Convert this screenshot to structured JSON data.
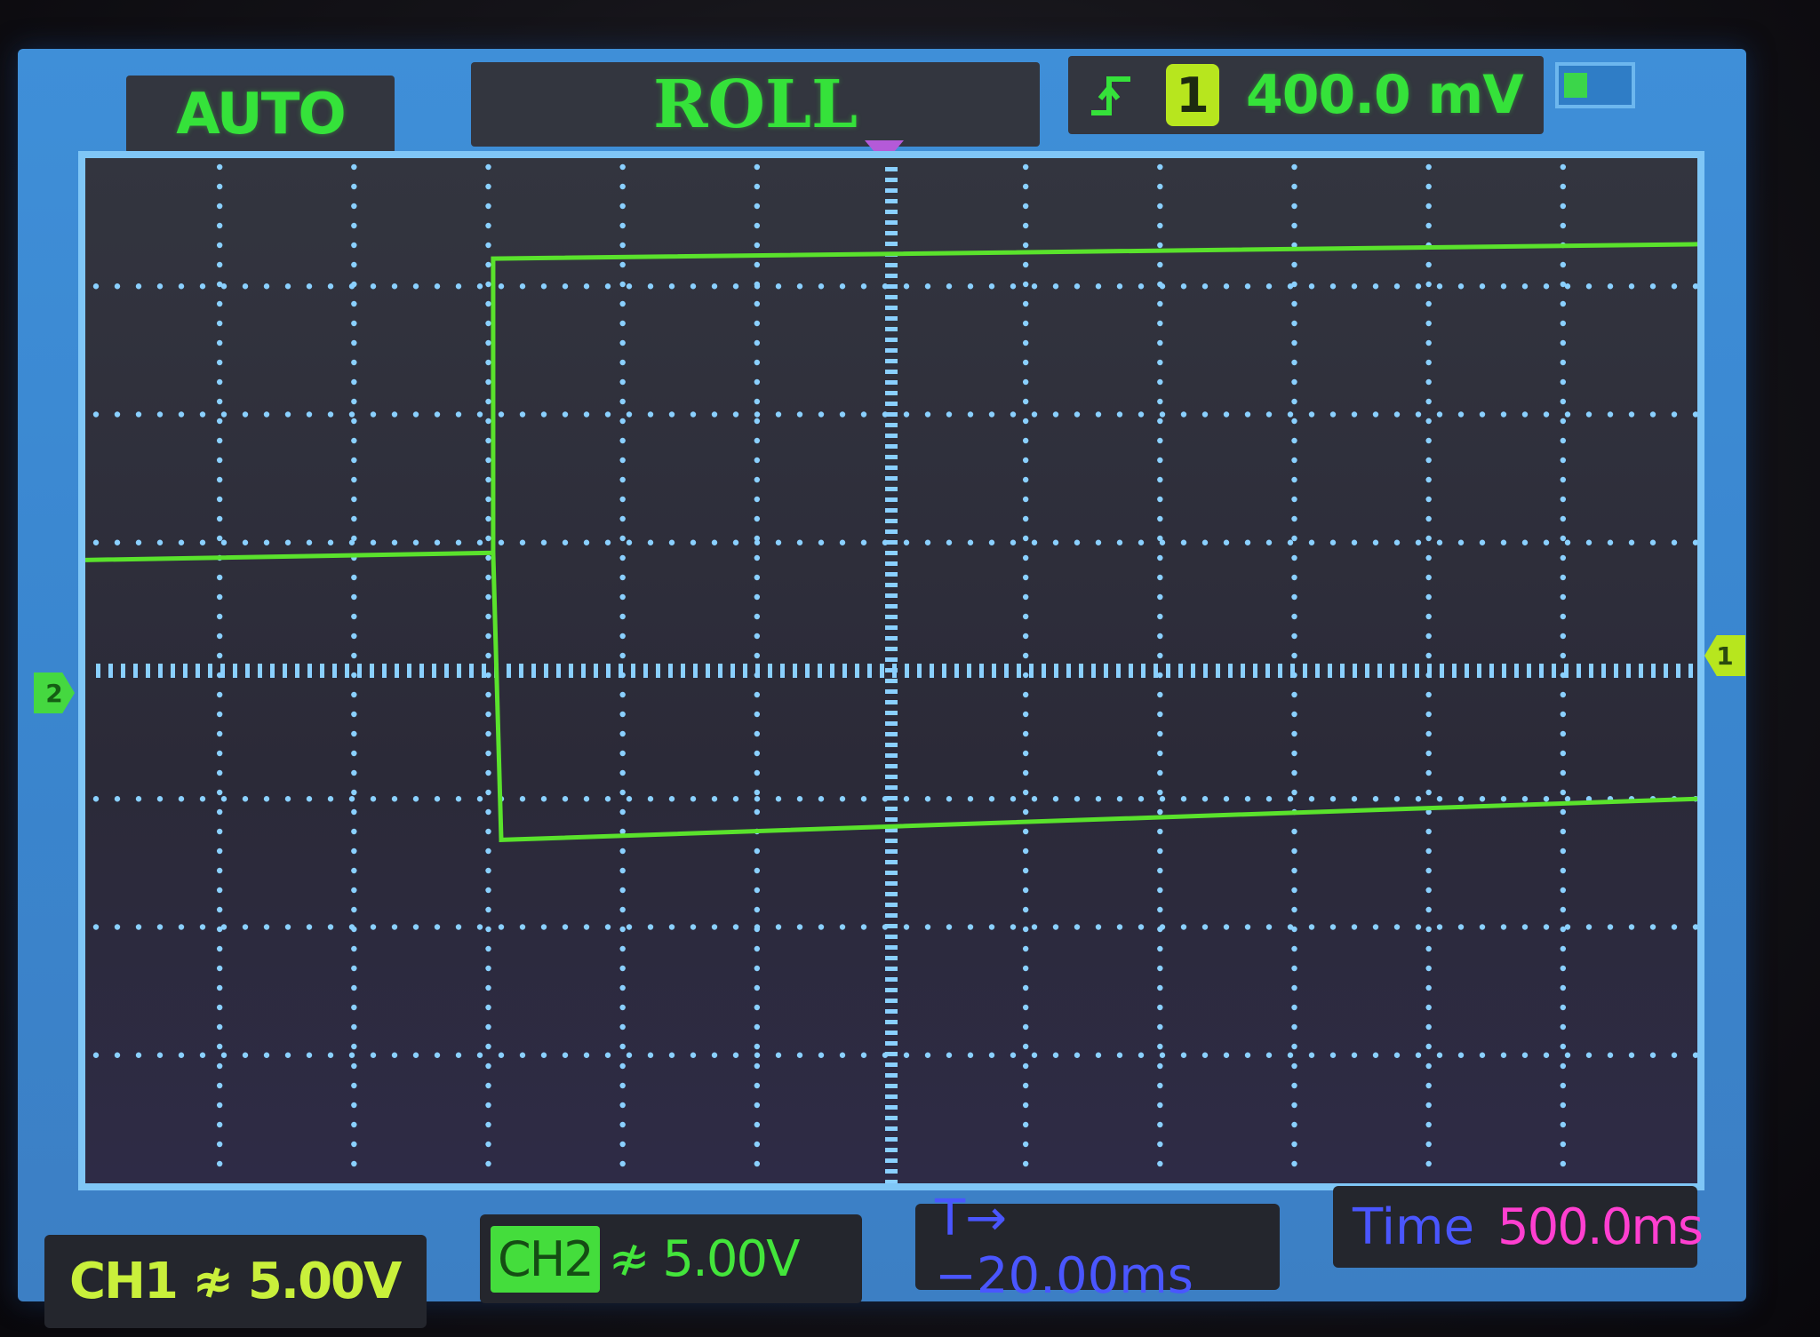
{
  "header": {
    "mode": "AUTO",
    "acquisition": "ROLL",
    "trigger_edge_icon": "rising-edge-icon",
    "trigger_source": "1",
    "trigger_level": "400.0 mV"
  },
  "markers": {
    "ch2_ground": "2",
    "trigger_level": "1"
  },
  "footer": {
    "ch1_scale": "CH1 ≉ 5.00V",
    "ch2_tag": "CH2",
    "ch2_scale": "≉ 5.00V",
    "trigger_offset": "T→ −20.00ms",
    "time_label": "Time",
    "time_value": "500.0ms"
  },
  "colors": {
    "trace": "#5ae22c",
    "grid": "#8ad0ff",
    "screen_frame": "#3f8fd8",
    "ch1": "#c9f03b",
    "ch2": "#43e53b",
    "trigger_offset": "#4a56ff",
    "timebase": "#ff3fd0"
  }
}
